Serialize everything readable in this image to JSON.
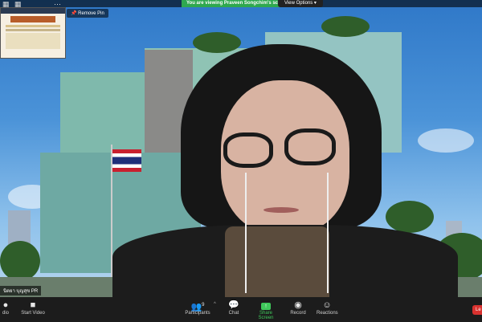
{
  "banner": {
    "sharing_text": "You are viewing Praveen Songchim's screen",
    "view_options": "View Options"
  },
  "pin": {
    "remove_label": "Remove Pin"
  },
  "participant": {
    "name": "นิตยา บุญสุข PR"
  },
  "toolbar": {
    "audio_label": "dio",
    "video_label": "Start Video",
    "participants_label": "Participants",
    "participants_count": "9",
    "chat_label": "Chat",
    "share_label": "Share Screen",
    "record_label": "Record",
    "reactions_label": "Reactions",
    "leave_label": "Le"
  },
  "colors": {
    "share_green": "#3fc85b",
    "leave_red": "#d9322f",
    "banner_green": "#2fa84f"
  }
}
